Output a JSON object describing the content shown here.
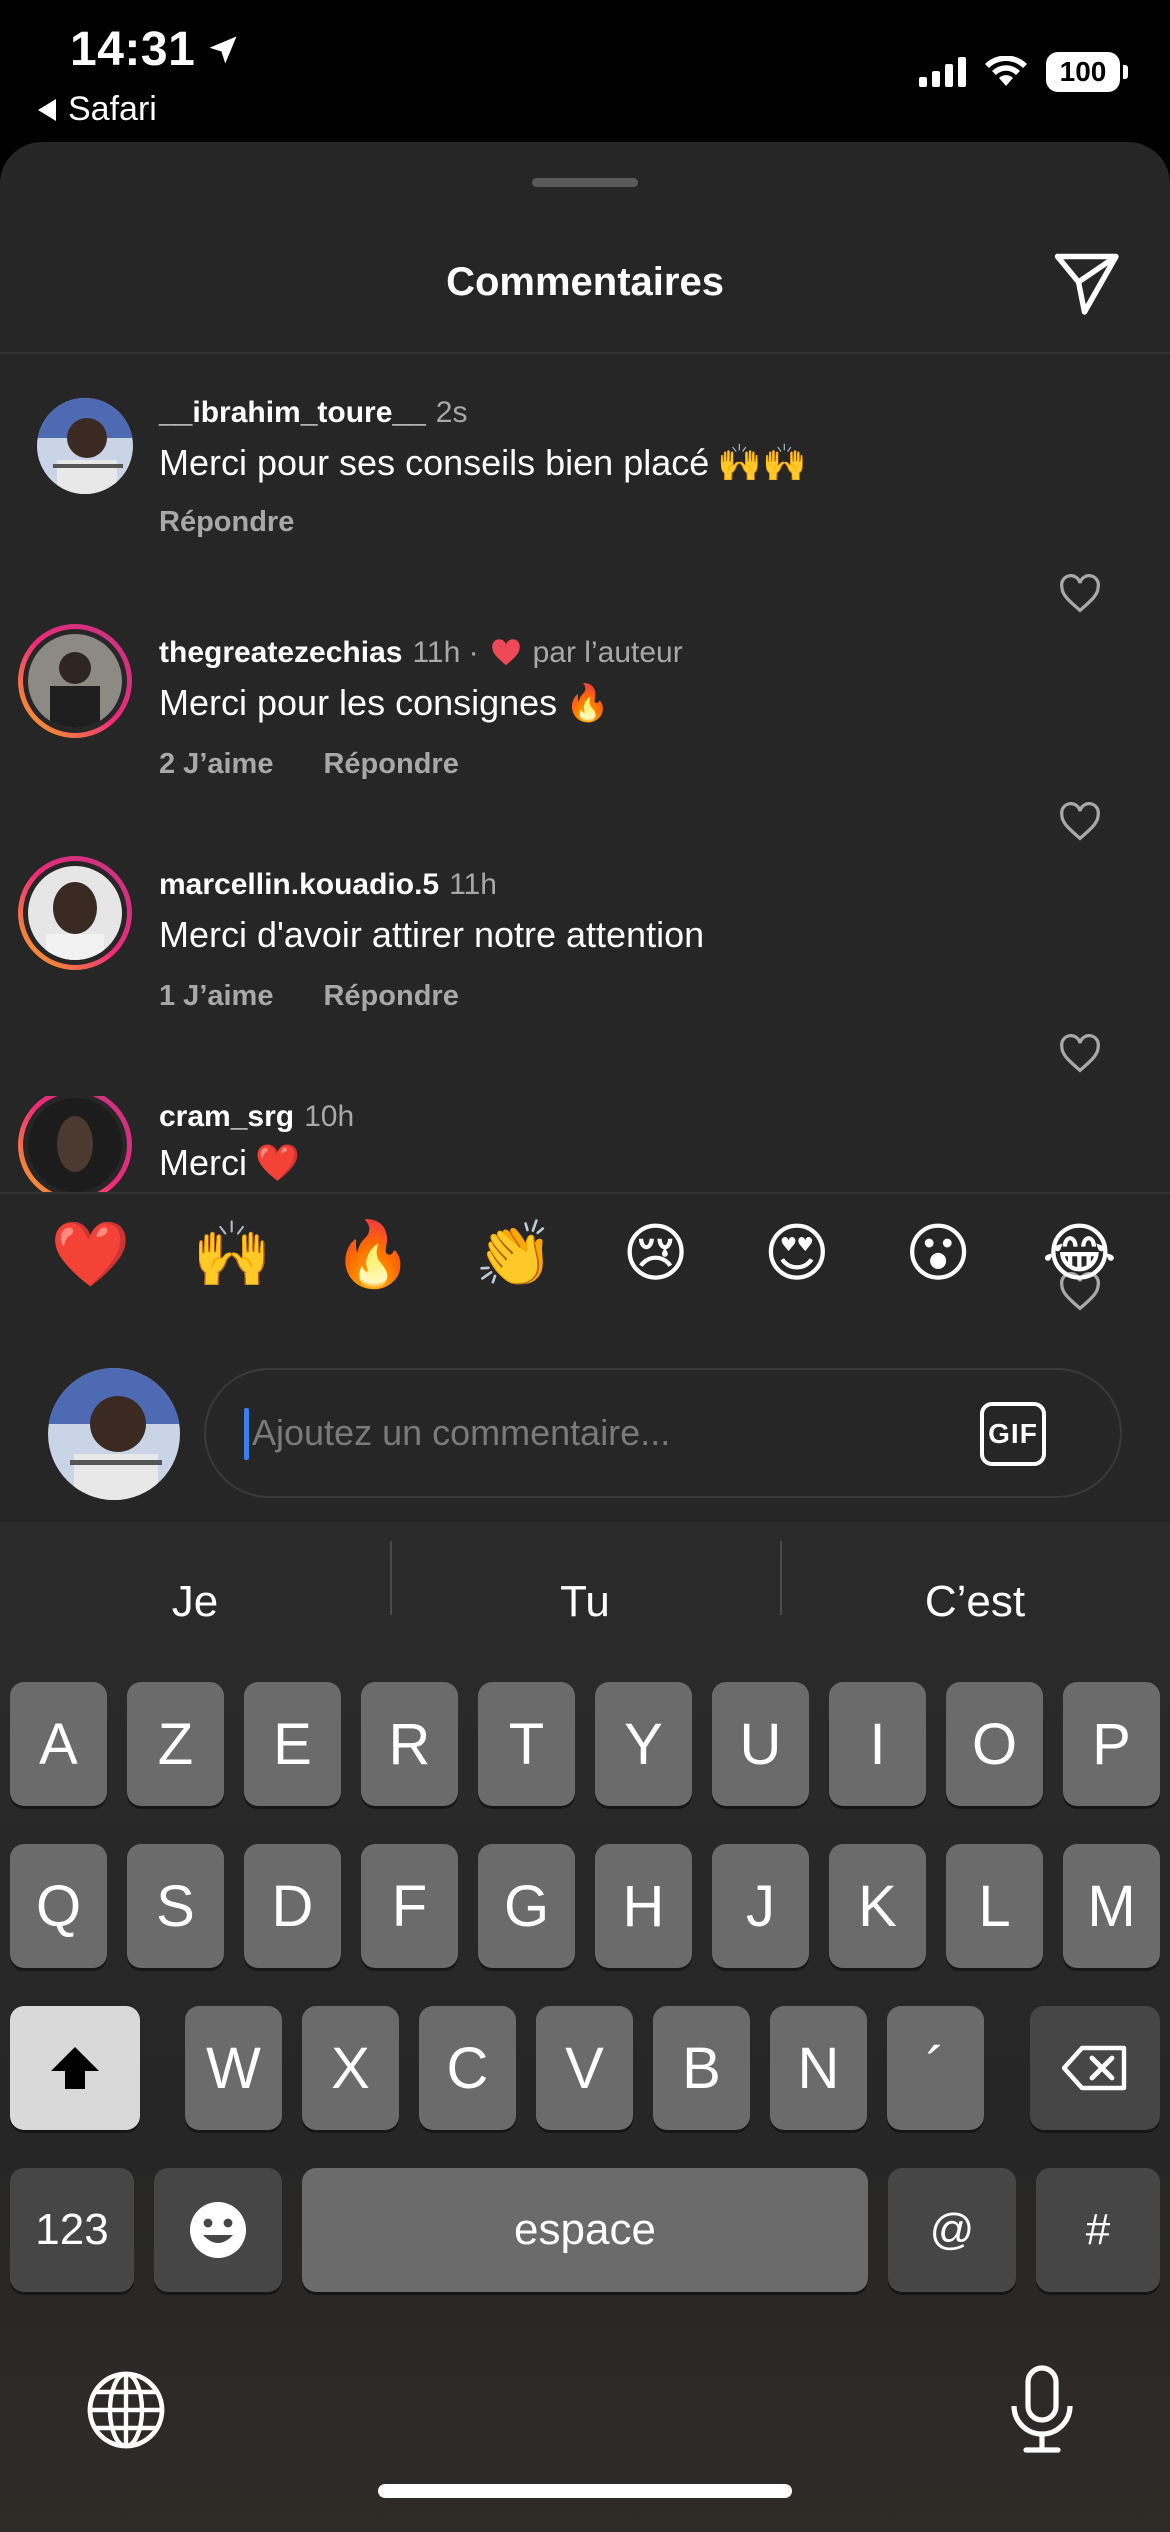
{
  "status_bar": {
    "time": "14:31",
    "back_label": "Safari",
    "battery": "100"
  },
  "sheet": {
    "title": "Commentaires"
  },
  "comments": [
    {
      "user": "__ibrahim_toure__",
      "time": "2s",
      "text": "Merci pour ses conseils bien placé",
      "emoji": "🙌🙌",
      "likes": "",
      "reply": "Répondre",
      "author_like": ""
    },
    {
      "user": "thegreatezechias",
      "time": "11h ·",
      "text": "Merci pour les consignes",
      "emoji": "🔥",
      "likes": "2 J’aime",
      "reply": "Répondre",
      "author_like": "par l’auteur"
    },
    {
      "user": "marcellin.kouadio.5",
      "time": "11h",
      "text": "Merci d'avoir attirer notre attention",
      "emoji": "",
      "likes": "1 J’aime",
      "reply": "Répondre",
      "author_like": ""
    },
    {
      "user": "cram_srg",
      "time": "10h",
      "text": "Merci",
      "emoji": "❤️",
      "likes": "",
      "reply": "",
      "author_like": ""
    }
  ],
  "emoji_bar": [
    "❤️",
    "🙌",
    "🔥",
    "👏",
    "😢",
    "😍",
    "😮",
    "😂"
  ],
  "input": {
    "placeholder": "Ajoutez un commentaire...",
    "gif_label": "GIF"
  },
  "keyboard": {
    "suggestions": [
      "Je",
      "Tu",
      "C’est"
    ],
    "row1": [
      "A",
      "Z",
      "E",
      "R",
      "T",
      "Y",
      "U",
      "I",
      "O",
      "P"
    ],
    "row2": [
      "Q",
      "S",
      "D",
      "F",
      "G",
      "H",
      "J",
      "K",
      "L",
      "M"
    ],
    "row3": [
      "W",
      "X",
      "C",
      "V",
      "B",
      "N",
      "´"
    ],
    "numbers_label": "123",
    "space_label": "espace",
    "at_label": "@",
    "hash_label": "#"
  },
  "colors": {
    "sheet_bg": "#262626",
    "accent_like": "#ed4956",
    "caret": "#3c7df0"
  }
}
